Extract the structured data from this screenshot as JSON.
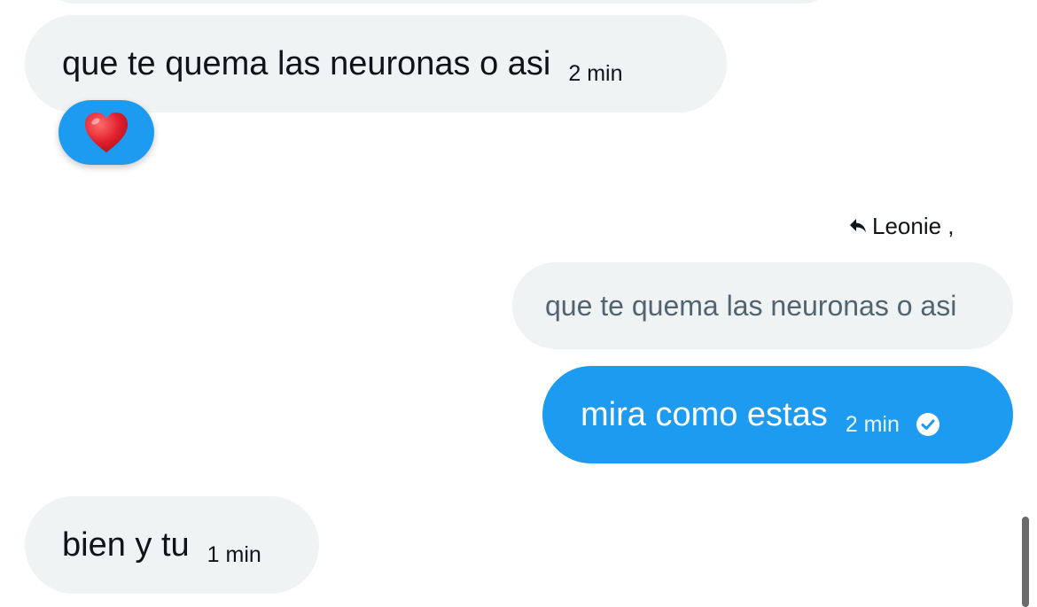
{
  "messages": [
    {
      "text": "que te quema las neuronas o asi",
      "time": "2 min",
      "reaction": "heart-emoji"
    },
    {
      "text": "mira como estas",
      "time": "2 min",
      "status": "sent-check-icon"
    },
    {
      "text": "bien y tu",
      "time": "1 min"
    }
  ],
  "reply": {
    "label": "Leonie ,",
    "quoted_text": "que te quema las neuronas o asi"
  },
  "colors": {
    "sent_bubble": "#1d9bf0",
    "received_bubble": "#eff3f4",
    "text": "#0f1419",
    "quoted_text": "#536471",
    "heart": "#e0202c"
  }
}
